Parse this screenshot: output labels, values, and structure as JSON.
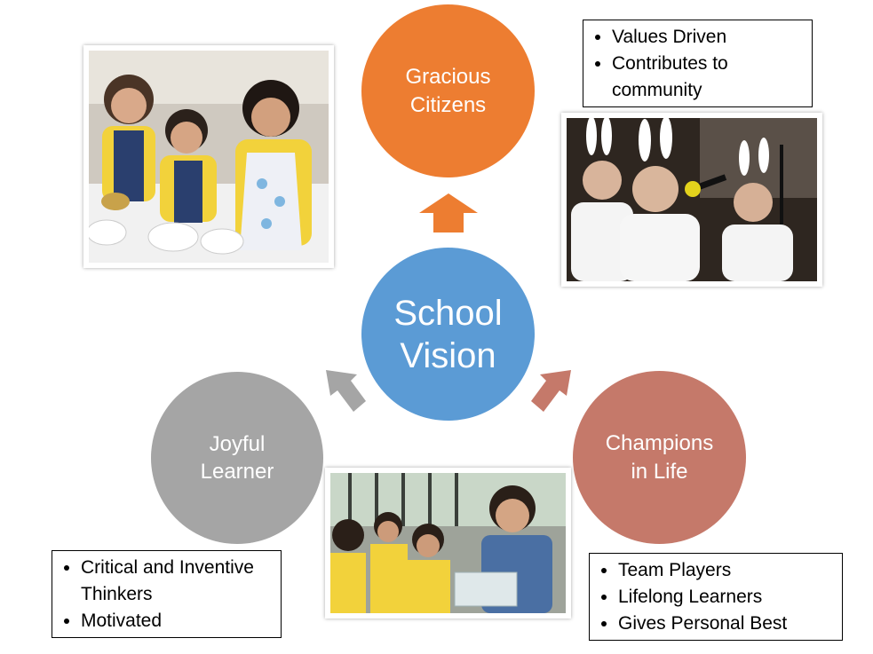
{
  "vision": {
    "label": "School\nVision",
    "color": "#5B9BD5"
  },
  "gracious": {
    "label": "Gracious\nCitizens",
    "color": "#ED7D31",
    "points": [
      "Values Driven",
      "Contributes to community"
    ]
  },
  "joyful": {
    "label": "Joyful\nLearner",
    "color": "#A5A5A5",
    "points": [
      "Critical and Inventive Thinkers",
      "Motivated"
    ]
  },
  "champions": {
    "label": "Champions\nin Life",
    "color": "#C5796A",
    "points": [
      "Team Players",
      "Lifelong Learners",
      "Gives Personal Best"
    ]
  },
  "photos": {
    "kids": "photo of students in yellow uniforms mixing in bowls",
    "stage": "photo of students in bunny costumes performing on stage",
    "teacher": "photo of teacher with students at a water tray"
  }
}
